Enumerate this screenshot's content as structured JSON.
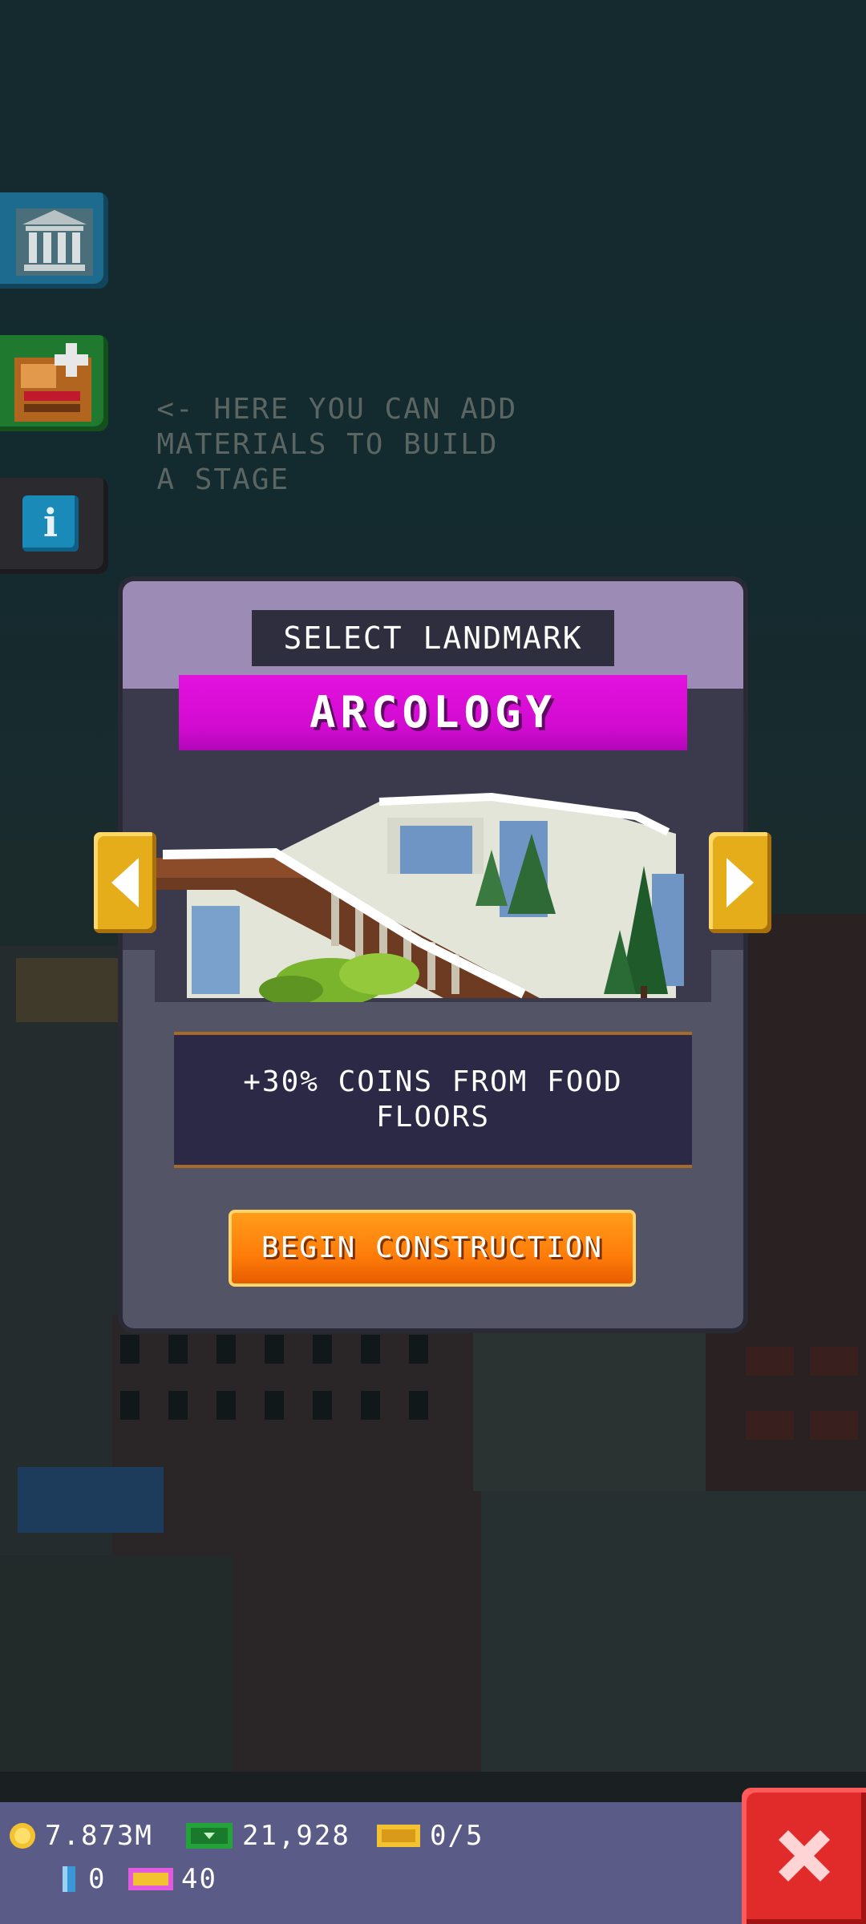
{
  "hint": {
    "arrow": "<-",
    "text": "HERE YOU CAN ADD\n  MATERIALS TO BUILD\n  A STAGE"
  },
  "side_buttons": [
    {
      "icon": "landmark-icon",
      "color": "#1d6b8e"
    },
    {
      "icon": "add-materials-icon",
      "color": "#1f7a2f"
    },
    {
      "icon": "info-icon",
      "color": "#2a2a2f"
    }
  ],
  "modal": {
    "title": "SELECT LANDMARK",
    "landmark_name": "ARCOLOGY",
    "bonus_text": "+30% COINS FROM FOOD FLOORS",
    "begin_label": "BEGIN CONSTRUCTION"
  },
  "bottom_bar": {
    "coins": "7.873M",
    "bux": "21,928",
    "tickets": "0/5",
    "gems": "0",
    "vip": "40"
  },
  "colors": {
    "accent_magenta": "#d10bd0",
    "button_orange": "#ff7d0a",
    "close_red": "#e12a2a",
    "arrow_gold": "#e5ad1a"
  }
}
